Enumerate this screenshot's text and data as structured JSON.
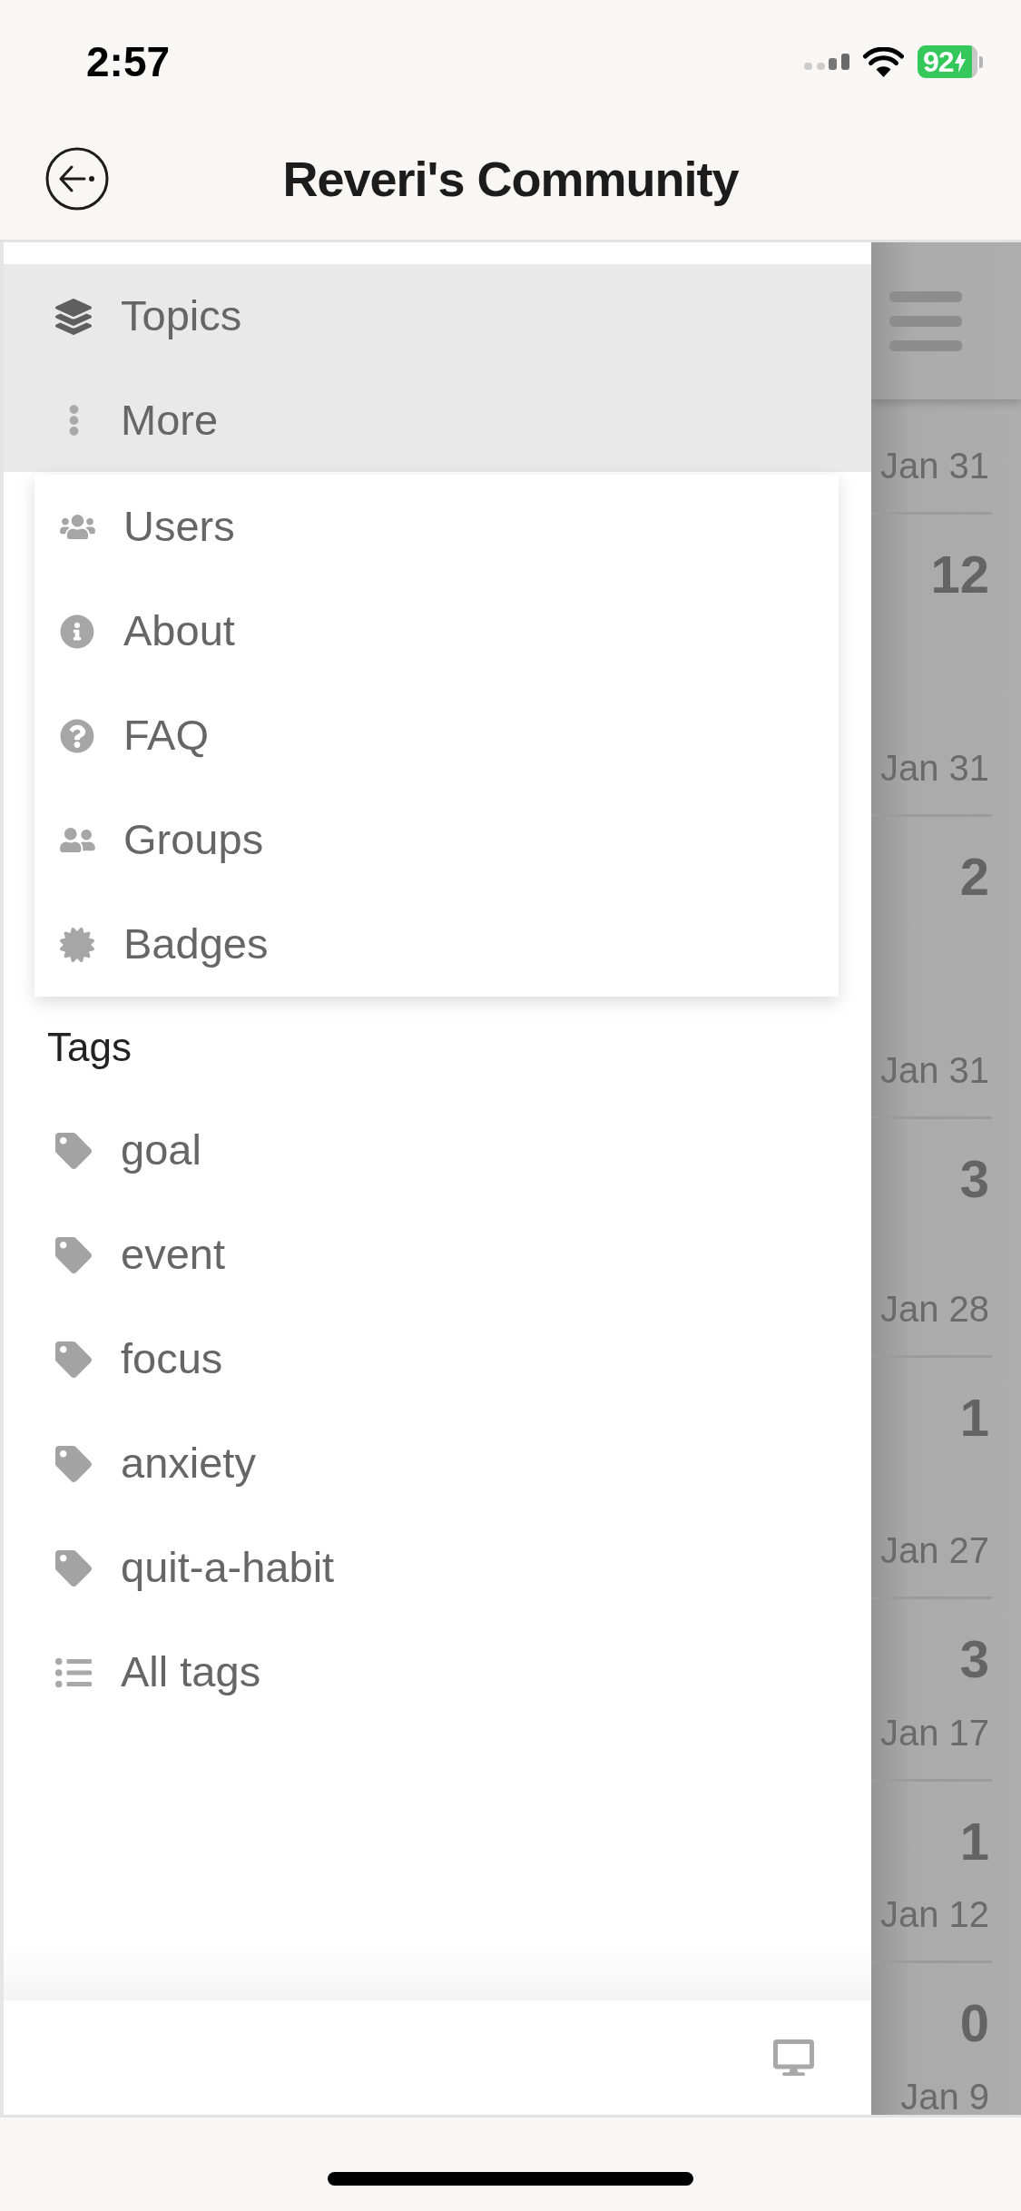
{
  "status_bar": {
    "time": "2:57",
    "battery": "92"
  },
  "nav": {
    "title": "Reveri's Community"
  },
  "sidebar": {
    "topics": "Topics",
    "more": {
      "label": "More",
      "expanded": true
    },
    "more_menu": [
      "Users",
      "About",
      "FAQ",
      "Groups",
      "Badges"
    ],
    "tags": {
      "heading": "Tags",
      "items": [
        "goal",
        "event",
        "focus",
        "anxiety",
        "quit-a-habit"
      ],
      "all_tags": "All tags"
    }
  },
  "topic_list": [
    {
      "date": "Jan 31"
    },
    {
      "number": "12",
      "date": "Jan 31"
    },
    {
      "number": "2",
      "date": "Jan 31"
    },
    {
      "number": "3",
      "date": "Jan 28"
    },
    {
      "number": "1",
      "date": "Jan 27"
    },
    {
      "number": "3",
      "date": "Jan 17"
    },
    {
      "number": "1",
      "date": "Jan 12"
    },
    {
      "number": "0",
      "date": "Jan 9"
    }
  ]
}
